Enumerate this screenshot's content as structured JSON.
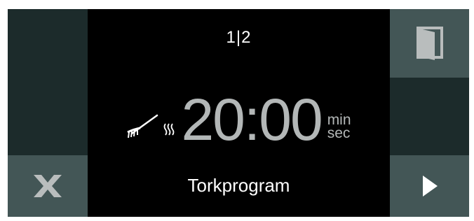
{
  "header": {
    "page_indicator": "1|2"
  },
  "timer": {
    "value": "20:00",
    "unit_top": "min",
    "unit_bottom": "sec"
  },
  "program": {
    "name": "Torkprogram",
    "icon": "brush-steam-icon"
  },
  "buttons": {
    "cancel_icon": "x-close-icon",
    "door_icon": "door-icon",
    "next_icon": "play-next-icon"
  },
  "colors": {
    "tile_dark": "#1c2b2b",
    "tile_light": "#435656",
    "timer_text": "#b3b7b7",
    "label_text": "#ffffff"
  }
}
